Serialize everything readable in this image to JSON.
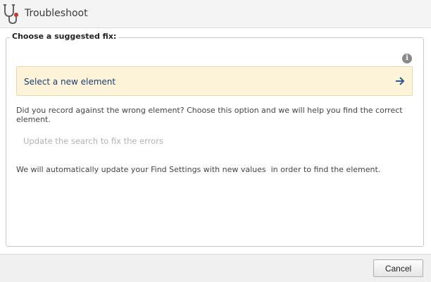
{
  "window": {
    "title": "Troubleshoot",
    "icon": "stethoscope-icon"
  },
  "panel": {
    "legend": "Choose a suggested fix:",
    "info_icon": "info-icon",
    "selected_option": {
      "label": "Select a new element",
      "icon": "arrow-right-icon"
    },
    "description": "Did you record against the wrong element? Choose this option and we will help you find the correct element.",
    "secondary_option": "Update the search to fix the errors",
    "note": "We will automatically update your Find Settings with new values  in order to find the element."
  },
  "footer": {
    "cancel_label": "Cancel"
  },
  "colors": {
    "highlight_bg": "#fcf3d9",
    "highlight_border": "#e8d9a8",
    "link_text": "#1b3d72",
    "arrow": "#2e5b8c",
    "muted_text": "#b3b3b3"
  }
}
